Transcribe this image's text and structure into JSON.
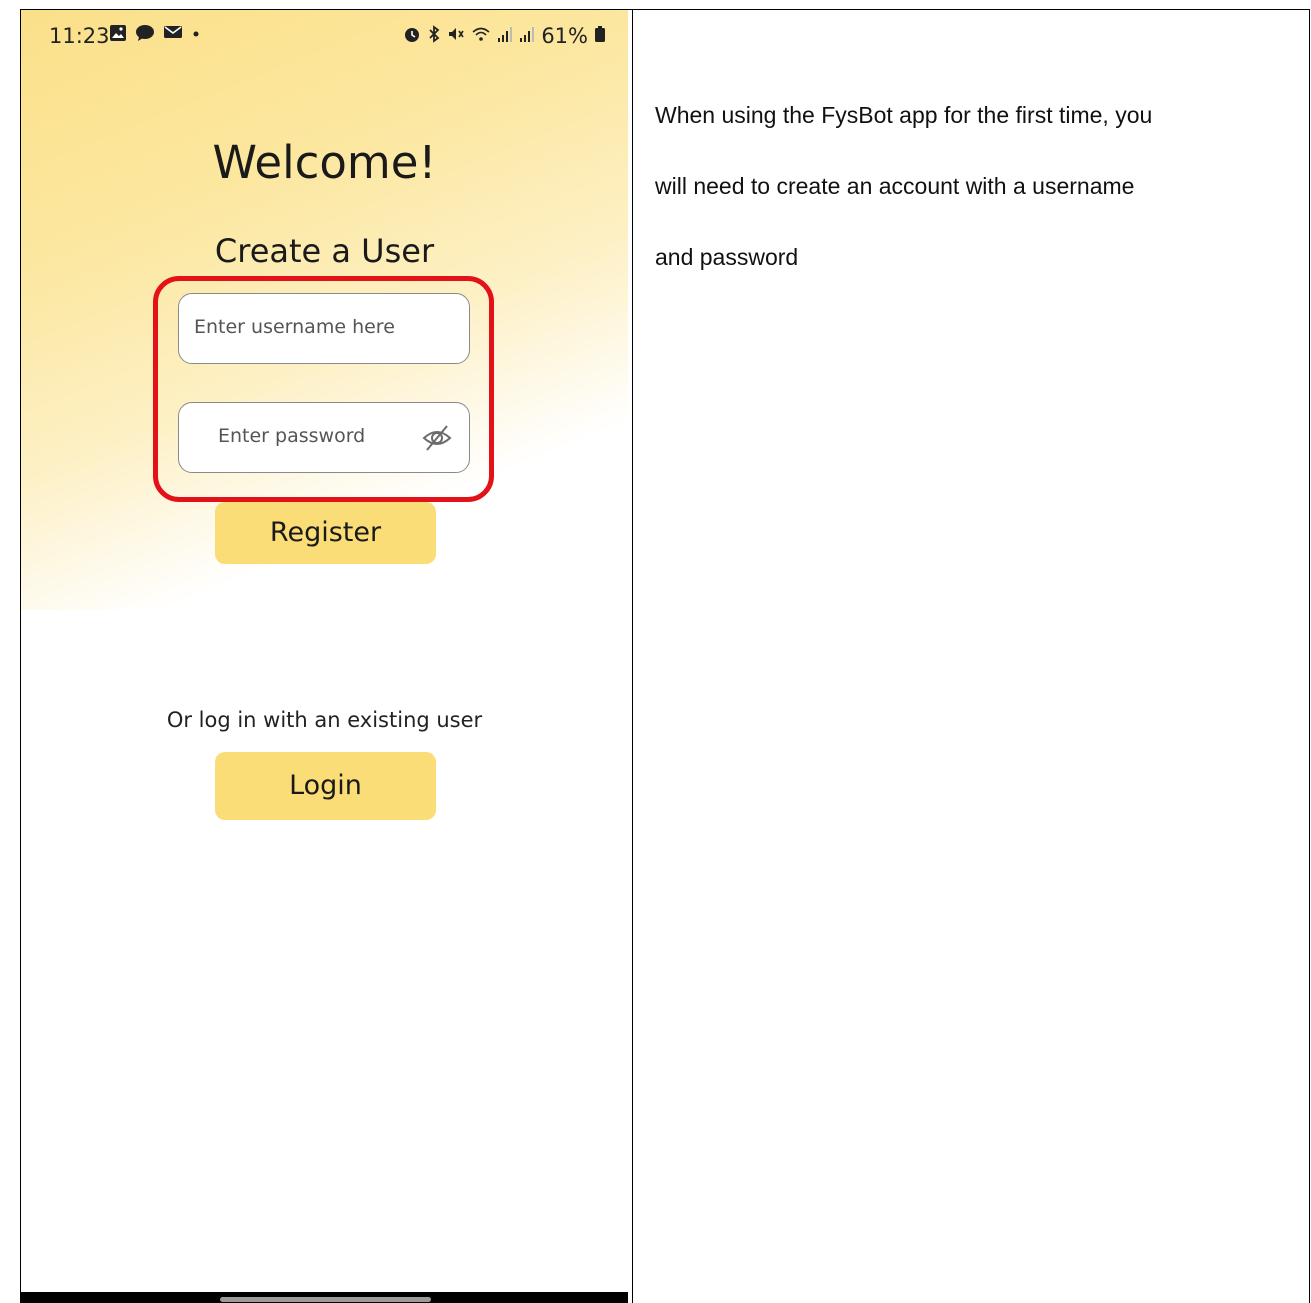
{
  "phone": {
    "status_bar": {
      "time": "11:23",
      "left_icons": [
        "gallery-icon",
        "chat-icon",
        "mail-icon",
        "dot-icon"
      ],
      "right_icons": [
        "alarm-icon",
        "bluetooth-icon",
        "mute-icon",
        "wifi-icon",
        "signal-icon",
        "signal-icon"
      ],
      "battery": "61%"
    },
    "welcome": "Welcome!",
    "create_user": "Create a User",
    "username_placeholder": "Enter username here",
    "password_placeholder": "Enter password",
    "register_label": "Register",
    "or_login_text": "Or log in with an existing user",
    "login_label": "Login",
    "highlight_color": "#e31218",
    "accent_color": "#fbdd78"
  },
  "description": {
    "line1": "When using the FysBot app for the first time, you",
    "line2": "will need to create an account with a username",
    "line3": "and password"
  }
}
